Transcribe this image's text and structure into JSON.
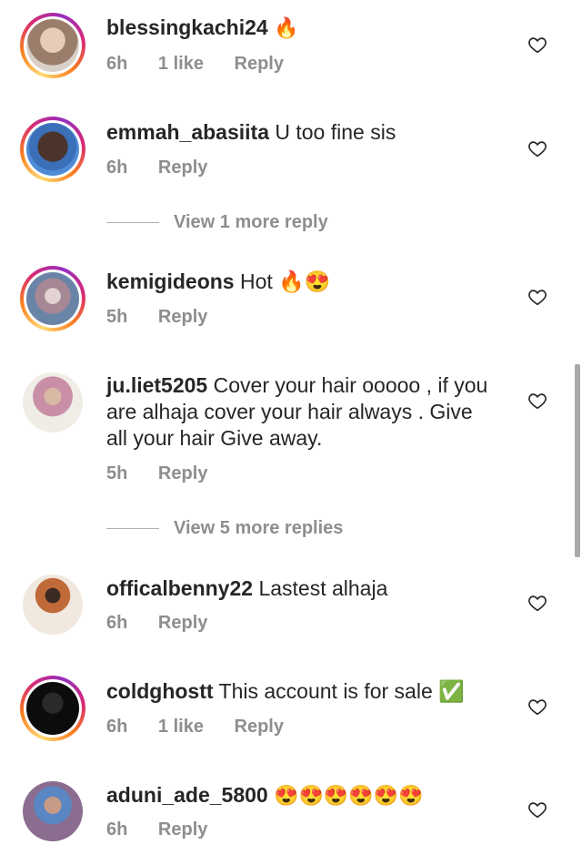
{
  "comments": [
    {
      "username": "blessingkachi24",
      "text": "🔥",
      "time": "6h",
      "likes": "1 like",
      "reply": "Reply",
      "ring": true,
      "avatar_color": "#c9a88e"
    },
    {
      "username": "emmah_abasiita",
      "text": "U too fine sis",
      "time": "6h",
      "likes": "",
      "reply": "Reply",
      "ring": true,
      "avatar_color": "#3a2a24"
    },
    {
      "username": "kemigideons",
      "text": "Hot 🔥😍",
      "time": "5h",
      "likes": "",
      "reply": "Reply",
      "ring": true,
      "avatar_color": "#9b7b86"
    },
    {
      "username": "ju.liet5205",
      "text": "Cover your hair ooooo , if you are alhaja cover your hair always . Give all your hair Give away.",
      "time": "5h",
      "likes": "",
      "reply": "Reply",
      "ring": false,
      "avatar_color": "#c7a48a"
    },
    {
      "username": "officalbenny22",
      "text": "Lastest alhaja",
      "time": "6h",
      "likes": "",
      "reply": "Reply",
      "ring": false,
      "avatar_color": "#d6b89a"
    },
    {
      "username": "coldghostt",
      "text": "This account is for sale ✅",
      "time": "6h",
      "likes": "1 like",
      "reply": "Reply",
      "ring": true,
      "avatar_color": "#111111"
    },
    {
      "username": "aduni_ade_5800",
      "text": "😍😍😍😍😍😍",
      "time": "6h",
      "likes": "",
      "reply": "Reply",
      "ring": false,
      "avatar_color": "#8a6d8f"
    }
  ],
  "view_more": [
    {
      "label": "View 1 more reply"
    },
    {
      "label": "View 5 more replies"
    }
  ],
  "icons": {
    "heart": "heart-outline-icon"
  },
  "colors": {
    "meta": "#8e8e8e",
    "text": "#262626"
  }
}
